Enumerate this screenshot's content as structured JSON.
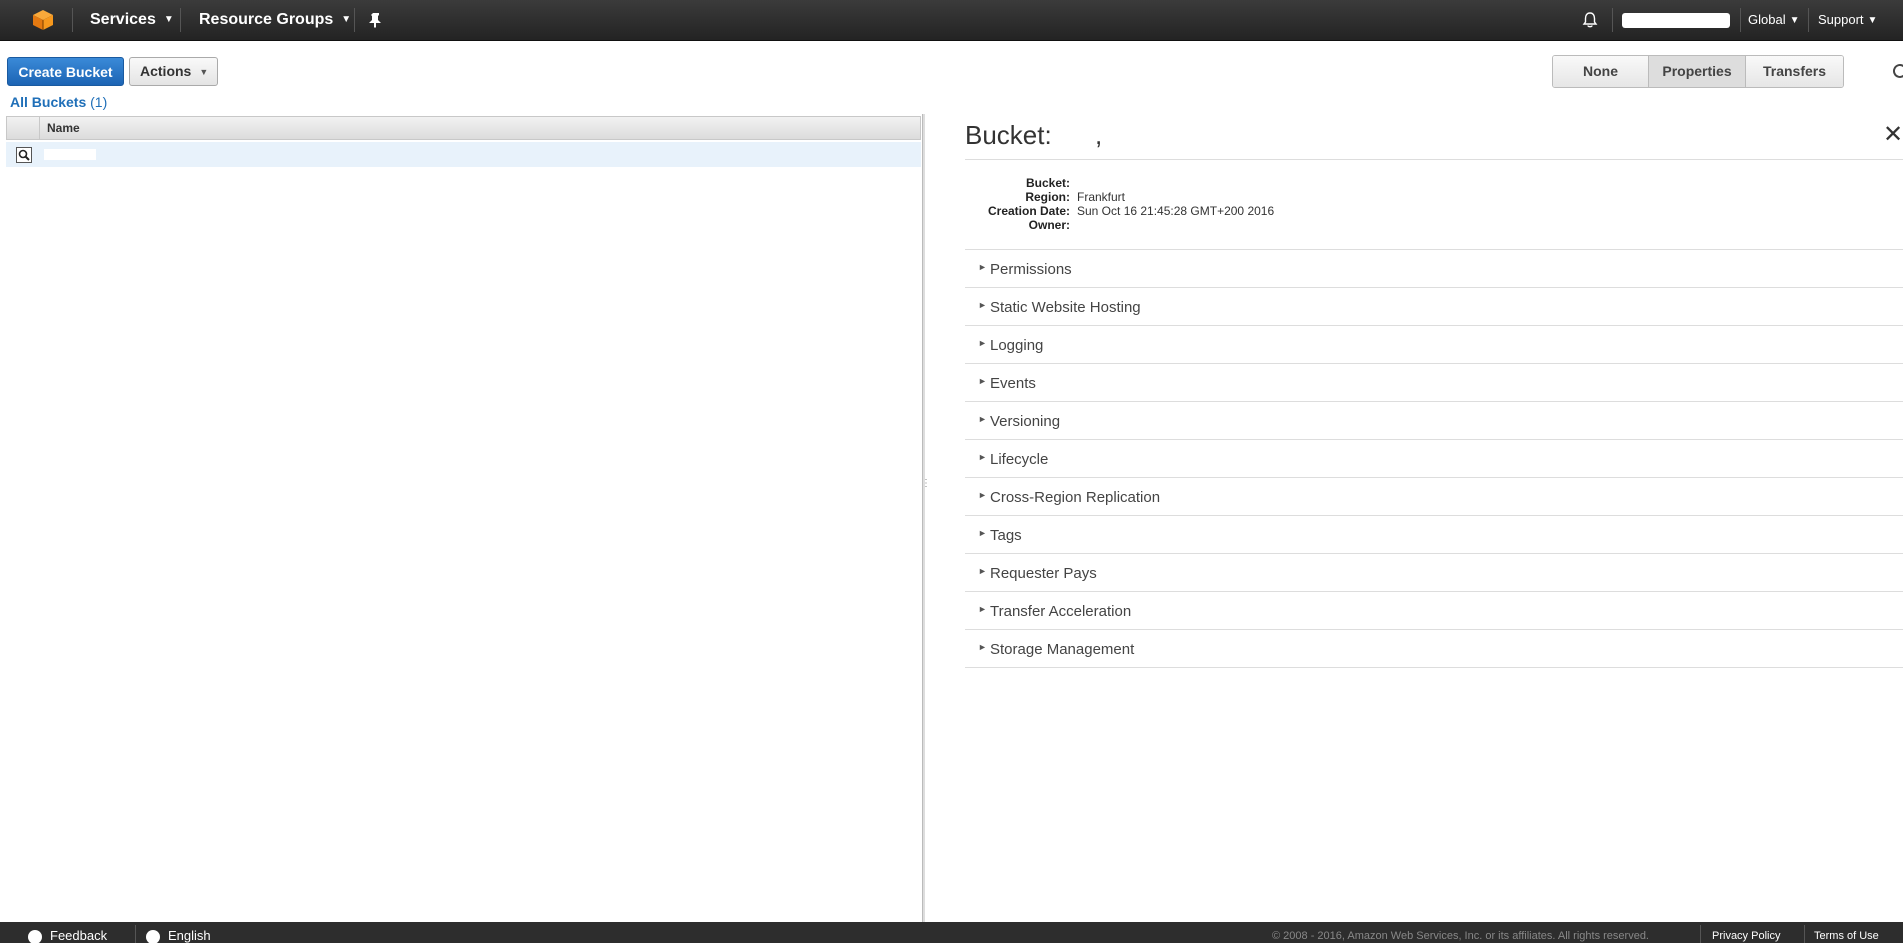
{
  "nav": {
    "services": "Services",
    "resource_groups": "Resource Groups",
    "region": "Global",
    "support": "Support"
  },
  "toolbar": {
    "create_bucket": "Create Bucket",
    "actions": "Actions",
    "views": [
      "None",
      "Properties",
      "Transfers"
    ],
    "active_view": "Properties"
  },
  "breadcrumb": {
    "label": "All Buckets",
    "count": "(1)"
  },
  "table": {
    "columns": [
      "Name"
    ]
  },
  "bucket": {
    "title": "Bucket:",
    "title_suffix": ",",
    "fields": [
      {
        "label": "Bucket:",
        "value": ""
      },
      {
        "label": "Region:",
        "value": "Frankfurt"
      },
      {
        "label": "Creation Date:",
        "value": "Sun Oct 16 21:45:28 GMT+200 2016"
      },
      {
        "label": "Owner:",
        "value": ""
      }
    ],
    "sections": [
      "Permissions",
      "Static Website Hosting",
      "Logging",
      "Events",
      "Versioning",
      "Lifecycle",
      "Cross-Region Replication",
      "Tags",
      "Requester Pays",
      "Transfer Acceleration",
      "Storage Management"
    ]
  },
  "footer": {
    "feedback": "Feedback",
    "language": "English",
    "copyright": "© 2008 - 2016, Amazon Web Services, Inc. or its affiliates. All rights reserved.",
    "privacy": "Privacy Policy",
    "terms": "Terms of Use"
  },
  "colors": {
    "nav_bg": "#2b2b2b",
    "primary_button": "#2a74c8",
    "link": "#1f6fb8",
    "selected_row": "#e8f2fb",
    "logo": "#f7981d"
  }
}
